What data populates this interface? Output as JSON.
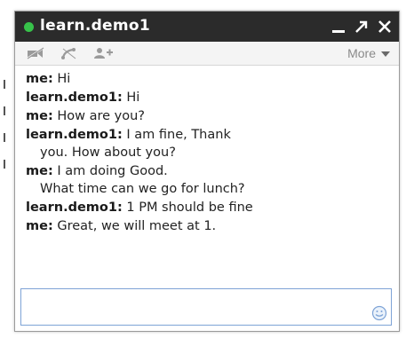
{
  "window": {
    "title": "learn.demo1",
    "status_color": "#37c24a"
  },
  "title_controls": {
    "minimize_icon": "minimize-icon",
    "popout_icon": "popout-arrow-icon",
    "close_icon": "close-icon"
  },
  "toolbar": {
    "video_icon": "video-call-icon",
    "phone_icon": "phone-call-icon",
    "add_person_icon": "add-person-icon",
    "more_label": "More"
  },
  "messages": [
    {
      "sender": "me:",
      "lines": [
        "Hi"
      ]
    },
    {
      "sender": "learn.demo1:",
      "lines": [
        "Hi"
      ]
    },
    {
      "sender": "me:",
      "lines": [
        "How are you?"
      ]
    },
    {
      "sender": "learn.demo1:",
      "lines": [
        "I am fine, Thank",
        "you. How about you?"
      ]
    },
    {
      "sender": "me:",
      "lines": [
        "I am doing Good.",
        "What time can we go for lunch?"
      ]
    },
    {
      "sender": "learn.demo1:",
      "lines": [
        "1 PM should be fine"
      ]
    },
    {
      "sender": "me:",
      "lines": [
        "Great, we will meet at 1."
      ]
    }
  ],
  "input": {
    "value": "",
    "emoticon_icon": "smiley-icon"
  }
}
